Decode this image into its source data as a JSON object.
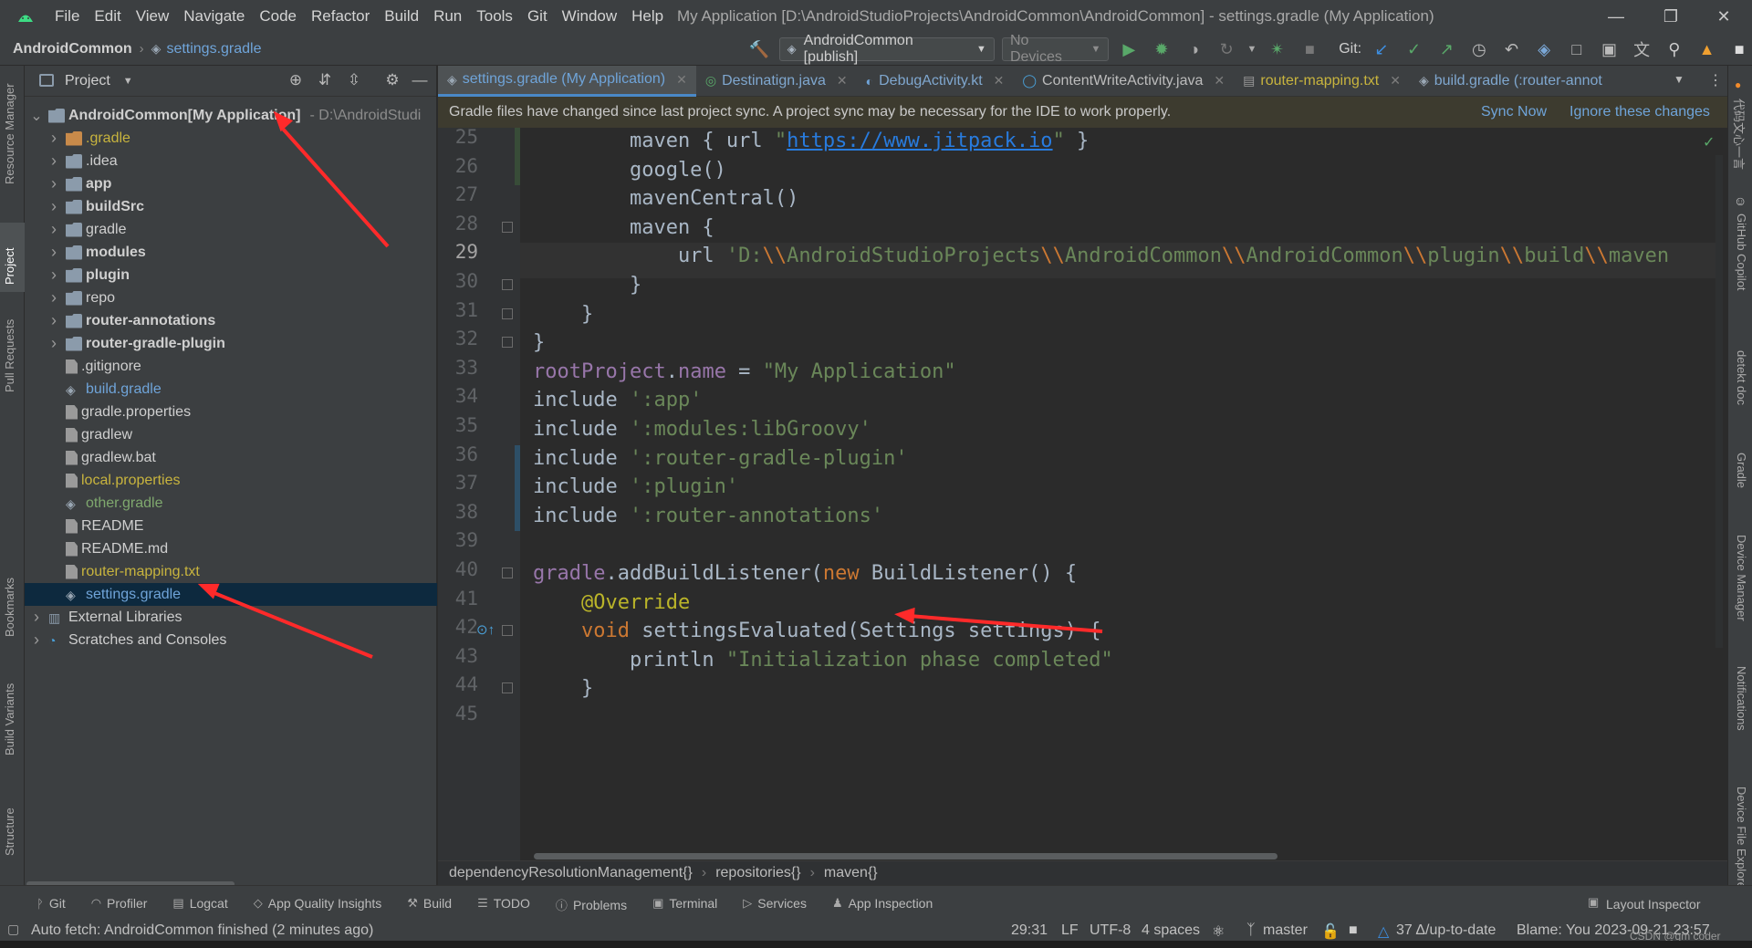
{
  "menubar": {
    "items": [
      "File",
      "Edit",
      "View",
      "Navigate",
      "Code",
      "Refactor",
      "Build",
      "Run",
      "Tools",
      "Git",
      "Window",
      "Help"
    ],
    "window_title": "My Application [D:\\AndroidStudioProjects\\AndroidCommon\\AndroidCommon] - settings.gradle (My Application)"
  },
  "navbar": {
    "root": "AndroidCommon",
    "file": "settings.gradle",
    "run_config": "AndroidCommon [publish]",
    "device": "No Devices",
    "git_label": "Git:"
  },
  "left_strip": {
    "resource_manager": "Resource Manager",
    "project": "Project",
    "pull_requests": "Pull Requests",
    "bookmarks": "Bookmarks",
    "build_variants": "Build Variants",
    "structure": "Structure"
  },
  "right_strip": {
    "copilot_cn": "代码文心一言",
    "github_copilot": "GitHub Copilot",
    "detekt": "detekt doc",
    "gradle": "Gradle",
    "device_manager": "Device Manager",
    "notifications": "Notifications",
    "device_file_explorer": "Device File Explorer"
  },
  "project_panel": {
    "title": "Project",
    "tree": [
      {
        "label": "AndroidCommon",
        "suffix": "[My Application]",
        "path": "D:\\AndroidStudi",
        "indent": 0,
        "type": "module",
        "expanded": true,
        "bold": true
      },
      {
        "label": ".gradle",
        "indent": 1,
        "type": "folder-orange",
        "color": "olive",
        "collapsed": true
      },
      {
        "label": ".idea",
        "indent": 1,
        "type": "folder",
        "collapsed": true
      },
      {
        "label": "app",
        "indent": 1,
        "type": "module",
        "collapsed": true,
        "bold": true
      },
      {
        "label": "buildSrc",
        "indent": 1,
        "type": "module",
        "collapsed": true,
        "bold": true
      },
      {
        "label": "gradle",
        "indent": 1,
        "type": "folder",
        "collapsed": true
      },
      {
        "label": "modules",
        "indent": 1,
        "type": "module",
        "collapsed": true,
        "bold": true
      },
      {
        "label": "plugin",
        "indent": 1,
        "type": "module",
        "collapsed": true,
        "bold": true
      },
      {
        "label": "repo",
        "indent": 1,
        "type": "folder",
        "collapsed": true
      },
      {
        "label": "router-annotations",
        "indent": 1,
        "type": "module",
        "collapsed": true,
        "bold": true
      },
      {
        "label": "router-gradle-plugin",
        "indent": 1,
        "type": "module",
        "collapsed": true,
        "bold": true
      },
      {
        "label": ".gitignore",
        "indent": 1,
        "type": "file"
      },
      {
        "label": "build.gradle",
        "indent": 1,
        "type": "gradle",
        "color": "blue"
      },
      {
        "label": "gradle.properties",
        "indent": 1,
        "type": "file"
      },
      {
        "label": "gradlew",
        "indent": 1,
        "type": "file"
      },
      {
        "label": "gradlew.bat",
        "indent": 1,
        "type": "file"
      },
      {
        "label": "local.properties",
        "indent": 1,
        "type": "file",
        "color": "olive"
      },
      {
        "label": "other.gradle",
        "indent": 1,
        "type": "gradle",
        "color": "green"
      },
      {
        "label": "README",
        "indent": 1,
        "type": "file"
      },
      {
        "label": "README.md",
        "indent": 1,
        "type": "file"
      },
      {
        "label": "router-mapping.txt",
        "indent": 1,
        "type": "file",
        "color": "olive"
      },
      {
        "label": "settings.gradle",
        "indent": 1,
        "type": "gradle",
        "color": "blue",
        "selected": true
      },
      {
        "label": "External Libraries",
        "indent": 0,
        "type": "libs",
        "collapsed": true
      },
      {
        "label": "Scratches and Consoles",
        "indent": 0,
        "type": "scratch",
        "collapsed": true
      }
    ]
  },
  "tabs": [
    {
      "label": "settings.gradle (My Application)",
      "active": true
    },
    {
      "label": "Destinatign.java"
    },
    {
      "label": "DebugActivity.kt"
    },
    {
      "label": "ContentWriteActivity.java"
    },
    {
      "label": "router-mapping.txt"
    },
    {
      "label": "build.gradle (:router-annot"
    }
  ],
  "banner": {
    "message": "Gradle files have changed since last project sync. A project sync may be necessary for the IDE to work properly.",
    "sync_now": "Sync Now",
    "ignore": "Ignore these changes"
  },
  "editor": {
    "current_line": "29",
    "lines": [
      {
        "n": "25",
        "tokens": [
          [
            "t",
            "        maven { url "
          ],
          [
            "s",
            "\""
          ],
          [
            "u",
            "https://www.jitpack.io"
          ],
          [
            "s",
            "\""
          ],
          [
            "t",
            " }"
          ]
        ]
      },
      {
        "n": "26",
        "tokens": [
          [
            "t",
            "        google()"
          ]
        ]
      },
      {
        "n": "27",
        "tokens": [
          [
            "t",
            "        mavenCentral()"
          ]
        ]
      },
      {
        "n": "28",
        "tokens": [
          [
            "t",
            "        maven {"
          ]
        ]
      },
      {
        "n": "29",
        "tokens": [
          [
            "t",
            "            url "
          ],
          [
            "s",
            "'D:"
          ],
          [
            "k",
            "\\\\"
          ],
          [
            "s",
            "AndroidStudioProjects"
          ],
          [
            "k",
            "\\\\"
          ],
          [
            "s",
            "AndroidCommon"
          ],
          [
            "k",
            "\\\\"
          ],
          [
            "s",
            "AndroidCommon"
          ],
          [
            "k",
            "\\\\"
          ],
          [
            "s",
            "plugin"
          ],
          [
            "k",
            "\\\\"
          ],
          [
            "s",
            "build"
          ],
          [
            "k",
            "\\\\"
          ],
          [
            "s",
            "maven"
          ]
        ]
      },
      {
        "n": "30",
        "tokens": [
          [
            "t",
            "        }"
          ]
        ]
      },
      {
        "n": "31",
        "tokens": [
          [
            "t",
            "    }"
          ]
        ]
      },
      {
        "n": "32",
        "tokens": [
          [
            "t",
            "}"
          ]
        ]
      },
      {
        "n": "33",
        "tokens": [
          [
            "p",
            "rootProject"
          ],
          [
            "t",
            "."
          ],
          [
            "p",
            "name"
          ],
          [
            "t",
            " = "
          ],
          [
            "s",
            "\"My Application\""
          ]
        ]
      },
      {
        "n": "34",
        "tokens": [
          [
            "t",
            "include "
          ],
          [
            "s",
            "':app'"
          ]
        ]
      },
      {
        "n": "35",
        "tokens": [
          [
            "t",
            "include "
          ],
          [
            "s",
            "':modules:libGroovy'"
          ]
        ]
      },
      {
        "n": "36",
        "tokens": [
          [
            "t",
            "include "
          ],
          [
            "s",
            "':router-gradle-plugin'"
          ]
        ]
      },
      {
        "n": "37",
        "tokens": [
          [
            "t",
            "include "
          ],
          [
            "s",
            "':plugin'"
          ]
        ]
      },
      {
        "n": "38",
        "tokens": [
          [
            "t",
            "include "
          ],
          [
            "s",
            "':router-annotations'"
          ]
        ]
      },
      {
        "n": "39",
        "tokens": []
      },
      {
        "n": "40",
        "tokens": [
          [
            "p",
            "gradle"
          ],
          [
            "t",
            ".addBuildListener("
          ],
          [
            "k",
            "new"
          ],
          [
            "t",
            " BuildListener() {"
          ]
        ]
      },
      {
        "n": "41",
        "tokens": [
          [
            "a",
            "    @Override"
          ]
        ]
      },
      {
        "n": "42",
        "tokens": [
          [
            "k",
            "    void"
          ],
          [
            "t",
            " settingsEvaluated(Settings settings) {"
          ]
        ]
      },
      {
        "n": "43",
        "tokens": [
          [
            "t",
            "        println "
          ],
          [
            "s",
            "\"Initialization phase completed\""
          ]
        ]
      },
      {
        "n": "44",
        "tokens": [
          [
            "t",
            "    }"
          ]
        ]
      },
      {
        "n": "45",
        "tokens": []
      }
    ]
  },
  "breadcrumb": [
    "dependencyResolutionManagement{}",
    "repositories{}",
    "maven{}"
  ],
  "bottom_tools": [
    "Git",
    "Profiler",
    "Logcat",
    "App Quality Insights",
    "Build",
    "TODO",
    "Problems",
    "Terminal",
    "Services",
    "App Inspection"
  ],
  "layout_inspector": "Layout Inspector",
  "status": {
    "message": "Auto fetch: AndroidCommon finished (2 minutes ago)",
    "position": "29:31",
    "line_sep": "LF",
    "encoding": "UTF-8",
    "indent": "4 spaces",
    "branch": "master",
    "vcs_state": "37 Δ/up-to-date",
    "blame": "Blame: You 2023-09-21 23:57",
    "watermark": "CSDN @qm coder"
  },
  "colors": {
    "arrow": "#ff2a2a",
    "accent": "#4a88c7"
  }
}
